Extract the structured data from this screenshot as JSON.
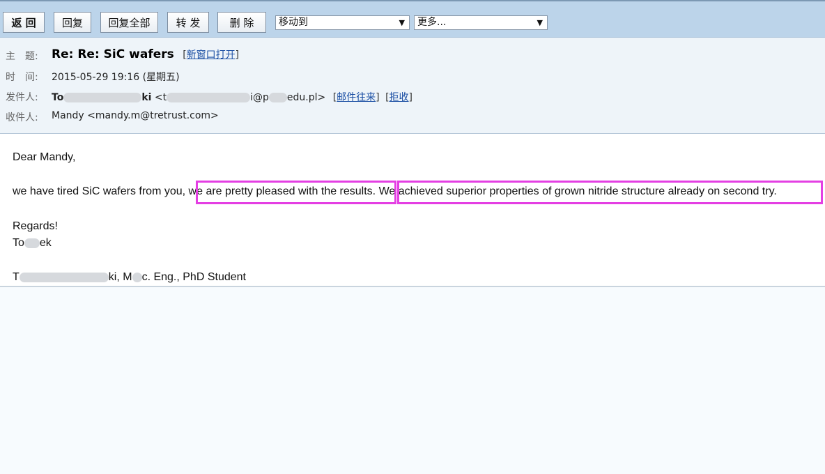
{
  "toolbar": {
    "back": "返 回",
    "reply": "回复",
    "reply_all": "回复全部",
    "forward": "转 发",
    "delete": "删 除",
    "move_to": "移动到",
    "more": "更多..."
  },
  "header": {
    "subject_label": "主　题:",
    "subject": "Re: Re: SiC wafers",
    "open_new_window": "新窗口打开",
    "time_label": "时　间:",
    "time": "2015-05-29 19:16 (星期五)",
    "from_label": "发件人:",
    "from_name_start": "To",
    "from_name_end": "ki",
    "from_email_start": "<t",
    "from_email_mid": "i@p",
    "from_email_end": "edu.pl>",
    "mail_history": "邮件往来",
    "reject": "拒收",
    "to_label": "收件人:",
    "to": "Mandy <mandy.m@tretrust.com>"
  },
  "body": {
    "greeting": "Dear Mandy,",
    "line_start": "we have tired SiC wafers from you,",
    "line_mid": "we are pretty pleased with the results.",
    "line_end": "We achieved superior properties of grown nitride structure already on second try.",
    "regards": "Regards!",
    "sign_start": "To",
    "sign_end": "ek",
    "title_start": "T",
    "title_mid": "ki, M",
    "title_end": "c. Eng., PhD Student"
  },
  "colors": {
    "toolbar_bg": "#bcd4ea",
    "header_bg": "#eef4f9",
    "highlight": "#e43fe3",
    "link": "#1a4ea3"
  }
}
